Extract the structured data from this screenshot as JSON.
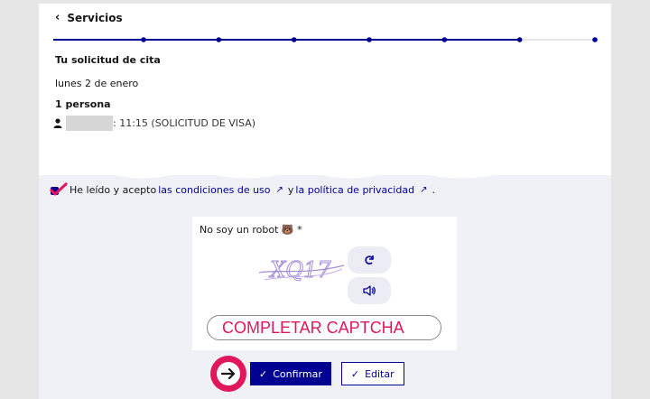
{
  "header": {
    "back_label": "Servicios"
  },
  "stepper": {
    "total_steps": 7,
    "completed_steps": 6
  },
  "summary": {
    "title": "Tu solicitud de cita",
    "date": "lunes 2 de enero",
    "persons": "1 persona",
    "slot_text": ": 11:15 (SOLICITUD DE VISA)"
  },
  "consent": {
    "prefix": "He leído y acepto ",
    "terms_link": "las condiciones de uso",
    "conjunction": " y ",
    "privacy_link": "la política de privacidad",
    "suffix": " ."
  },
  "captcha": {
    "label": "No soy un robot 🐻 *",
    "image_text": "XQ17",
    "input_value": "COMPLETAR CAPTCHA",
    "refresh_icon": "refresh-icon",
    "audio_icon": "speaker-icon"
  },
  "actions": {
    "confirm_label": "Confirmar",
    "edit_label": "Editar"
  },
  "colors": {
    "primary": "#000091",
    "accent": "#e0185b",
    "background": "#f0f0f7"
  }
}
